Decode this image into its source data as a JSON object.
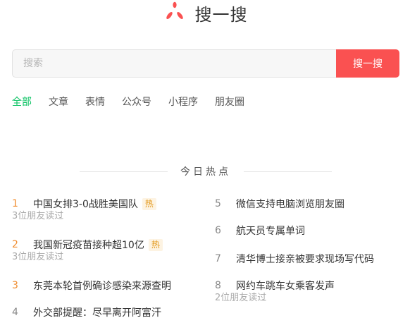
{
  "header": {
    "logo_icon": "wechat-search-logo-icon",
    "title": "搜一搜"
  },
  "search": {
    "placeholder": "搜索",
    "value": "",
    "button_label": "搜一搜"
  },
  "tabs": [
    {
      "label": "全部",
      "active": true
    },
    {
      "label": "文章",
      "active": false
    },
    {
      "label": "表情",
      "active": false
    },
    {
      "label": "公众号",
      "active": false
    },
    {
      "label": "小程序",
      "active": false
    },
    {
      "label": "朋友圈",
      "active": false
    }
  ],
  "hot": {
    "title": "今日热点",
    "left": [
      {
        "rank": "1",
        "text": "中国女排3-0战胜美国队",
        "badge": "热",
        "sub": "3位朋友读过"
      },
      {
        "rank": "2",
        "text": "我国新冠疫苗接种超10亿",
        "badge": "热",
        "sub": "3位朋友读过"
      },
      {
        "rank": "3",
        "text": "东莞本轮首例确诊感染来源查明",
        "badge": "",
        "sub": ""
      },
      {
        "rank": "4",
        "text": "外交部提醒：尽早离开阿富汗",
        "badge": "",
        "sub": ""
      }
    ],
    "right": [
      {
        "rank": "5",
        "text": "微信支持电脑浏览朋友圈",
        "badge": "",
        "sub": ""
      },
      {
        "rank": "6",
        "text": "航天员专属单词",
        "badge": "",
        "sub": ""
      },
      {
        "rank": "7",
        "text": "清华博士接亲被要求现场写代码",
        "badge": "",
        "sub": ""
      },
      {
        "rank": "8",
        "text": "网约车跳车女乘客发声",
        "badge": "",
        "sub": "2位朋友读过"
      }
    ]
  },
  "colors": {
    "accent_green": "#07c160",
    "search_button": "#fa5151",
    "rank_top": "#f08c2e",
    "badge_bg": "#fdf3e2",
    "badge_text": "#e39a1e"
  }
}
